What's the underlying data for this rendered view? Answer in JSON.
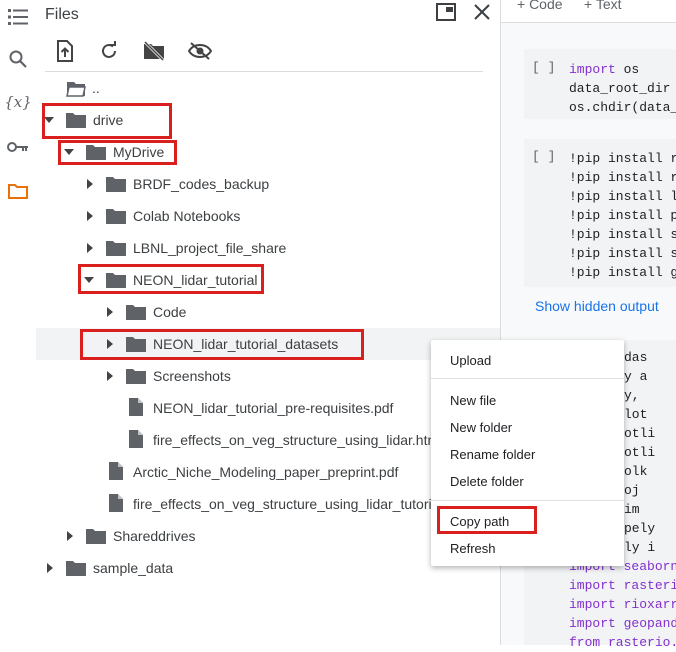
{
  "panel": {
    "title": "Files"
  },
  "toolbar": {
    "upload_icon": "upload-file-icon",
    "refresh_icon": "refresh-icon",
    "unmount_icon": "drive-off-icon",
    "hidden_icon": "visibility-off-icon"
  },
  "tree": {
    "parent": "..",
    "drive": "drive",
    "mydrive": "MyDrive",
    "brdf": "BRDF_codes_backup",
    "colab": "Colab Notebooks",
    "lbnl": "LBNL_project_file_share",
    "neon": "NEON_lidar_tutorial",
    "code": "Code",
    "datasets": "NEON_lidar_tutorial_datasets",
    "screenshots": "Screenshots",
    "prereq": "NEON_lidar_tutorial_pre-requisites.pdf",
    "fire_html": "fire_effects_on_veg_structure_using_lidar.htm",
    "arctic": "Arctic_Niche_Modeling_paper_preprint.pdf",
    "fire2": "fire_effects_on_veg_structure_using_lidar_tutoria",
    "shared": "Shareddrives",
    "sample": "sample_data"
  },
  "context_menu": {
    "upload": "Upload",
    "new_file": "New file",
    "new_folder": "New folder",
    "rename_folder": "Rename folder",
    "delete_folder": "Delete folder",
    "copy_path": "Copy path",
    "refresh": "Refresh"
  },
  "notebook": {
    "add_code": "+ Code",
    "add_text": "+ Text",
    "cell1": [
      "import os",
      "data_root_dir",
      "os.chdir(data_"
    ],
    "cell2": [
      "!pip install r",
      "!pip install r",
      "!pip install l",
      "!pip install p",
      "!pip install s",
      "!pip install s",
      "!pip install g"
    ],
    "show_hidden": "Show hidden output",
    "cell3_tail": [
      "das",
      "y a",
      "y,",
      "lot",
      "otli",
      "otli",
      "olk",
      "oj",
      "im",
      "pely",
      "ly i",
      "import seaborn",
      "import rasteri",
      "import rioxarr",
      "import geopand",
      "from rasterio."
    ],
    "run_bracket": "[ ]"
  },
  "colors": {
    "accent_red": "#d9201e",
    "selected_row": "#f1f3f4",
    "code_keyword": "#8430ce",
    "link": "#1a73e8"
  }
}
